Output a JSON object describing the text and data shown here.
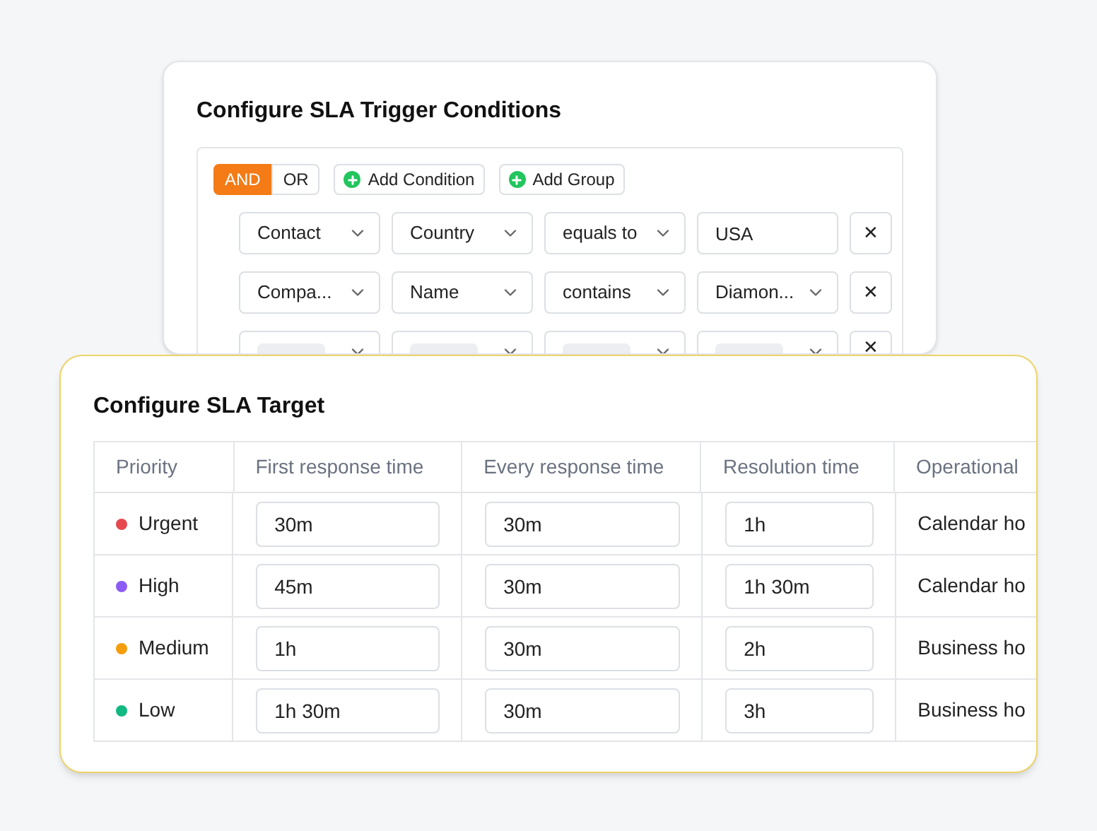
{
  "trigger_card": {
    "title": "Configure SLA Trigger Conditions",
    "logic": [
      {
        "label": "AND",
        "selected": true
      },
      {
        "label": "OR",
        "selected": false
      }
    ],
    "actions": [
      "Add Condition",
      "Add Group"
    ],
    "conditions": [
      {
        "fields": [
          {
            "kind": "select",
            "value": "Contact"
          },
          {
            "kind": "select",
            "value": "Country"
          },
          {
            "kind": "select",
            "value": "equals to"
          },
          {
            "kind": "input",
            "value": "USA"
          }
        ],
        "remove": "✕"
      },
      {
        "fields": [
          {
            "kind": "select",
            "value": "Compa..."
          },
          {
            "kind": "select",
            "value": "Name"
          },
          {
            "kind": "select",
            "value": "contains"
          },
          {
            "kind": "select",
            "value": "Diamon..."
          }
        ],
        "remove": "✕"
      },
      {
        "fields": [
          {
            "kind": "loading"
          },
          {
            "kind": "loading"
          },
          {
            "kind": "loading"
          },
          {
            "kind": "loading"
          }
        ],
        "remove": "✕"
      }
    ]
  },
  "target_card": {
    "title": "Configure SLA Target",
    "columns": [
      "Priority",
      "First response time",
      "Every response time",
      "Resolution time",
      "Operational"
    ],
    "rows": [
      {
        "priority": "Urgent",
        "color": "#e5484d",
        "first": "30m",
        "every": "30m",
        "resolution": "1h",
        "hours": "Calendar ho"
      },
      {
        "priority": "High",
        "color": "#8b5cf6",
        "first": "45m",
        "every": "30m",
        "resolution": "1h 30m",
        "hours": "Calendar ho"
      },
      {
        "priority": "Medium",
        "color": "#f59e0b",
        "first": "1h",
        "every": "30m",
        "resolution": "2h",
        "hours": "Business ho"
      },
      {
        "priority": "Low",
        "color": "#10b981",
        "first": "1h 30m",
        "every": "30m",
        "resolution": "3h",
        "hours": "Business ho"
      }
    ]
  }
}
